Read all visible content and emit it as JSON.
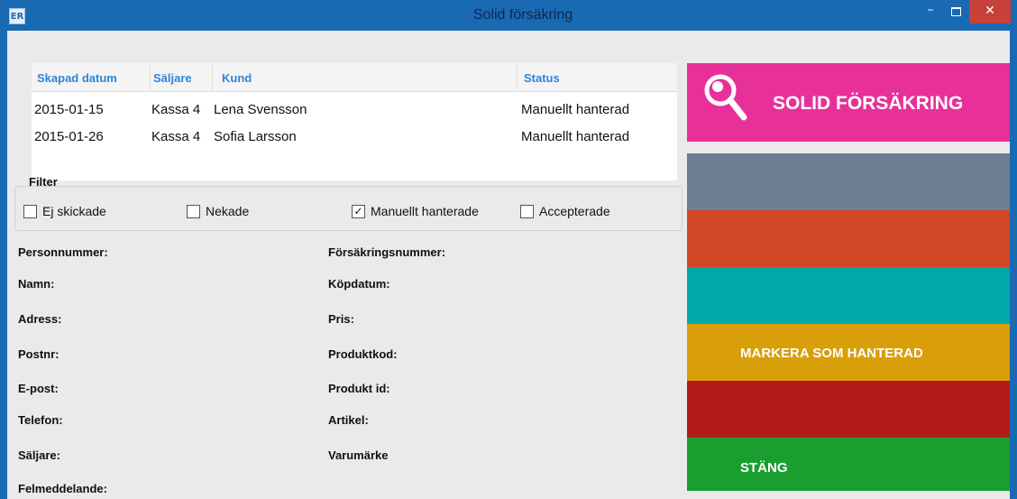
{
  "window": {
    "title": "Solid försäkring",
    "icon_text": "ER",
    "minimize_glyph": "–",
    "close_glyph": "✕"
  },
  "table": {
    "columns": [
      "Skapad datum",
      "Säljare",
      "Kund",
      "Status"
    ],
    "rows": [
      {
        "date": "2015-01-15",
        "seller": "Kassa 4",
        "customer": "Lena  Svensson",
        "status": "Manuellt hanterad"
      },
      {
        "date": "2015-01-26",
        "seller": "Kassa 4",
        "customer": "Sofia  Larsson",
        "status": "Manuellt hanterad"
      }
    ]
  },
  "filter": {
    "title": "Filter",
    "options": [
      {
        "label": "Ej skickade",
        "checked": false
      },
      {
        "label": "Nekade",
        "checked": false
      },
      {
        "label": "Manuellt hanterade",
        "checked": true
      },
      {
        "label": "Accepterade",
        "checked": false
      }
    ],
    "check_glyph": "✓"
  },
  "info": {
    "left": [
      "Personnummer:",
      "Namn:",
      "Adress:",
      "Postnr:",
      "E-post:",
      "Telefon:",
      "Säljare:",
      "Felmeddelande:"
    ],
    "right": [
      "Försäkringsnummer:",
      "Köpdatum:",
      "Pris:",
      "Produktkod:",
      "Produkt id:",
      "Artikel:",
      "Varumärke"
    ]
  },
  "panel": {
    "logo_text": "SOLID FÖRSÄKRING",
    "logo_color": "#e8309a",
    "tiles": [
      {
        "label": "",
        "color": "#6d7d93"
      },
      {
        "label": "",
        "color": "#d24726"
      },
      {
        "label": "",
        "color": "#00a8ac"
      },
      {
        "label": "MARKERA SOM HANTERAD",
        "color": "#d89f0a"
      },
      {
        "label": "",
        "color": "#b31b1b"
      },
      {
        "label": "STÄNG",
        "color": "#1b9e30"
      }
    ]
  },
  "colors": {
    "titlebar": "#1a69b3",
    "client_bg": "#eaeaea",
    "header_text": "#2e85d6",
    "close_button": "#c7413a"
  }
}
